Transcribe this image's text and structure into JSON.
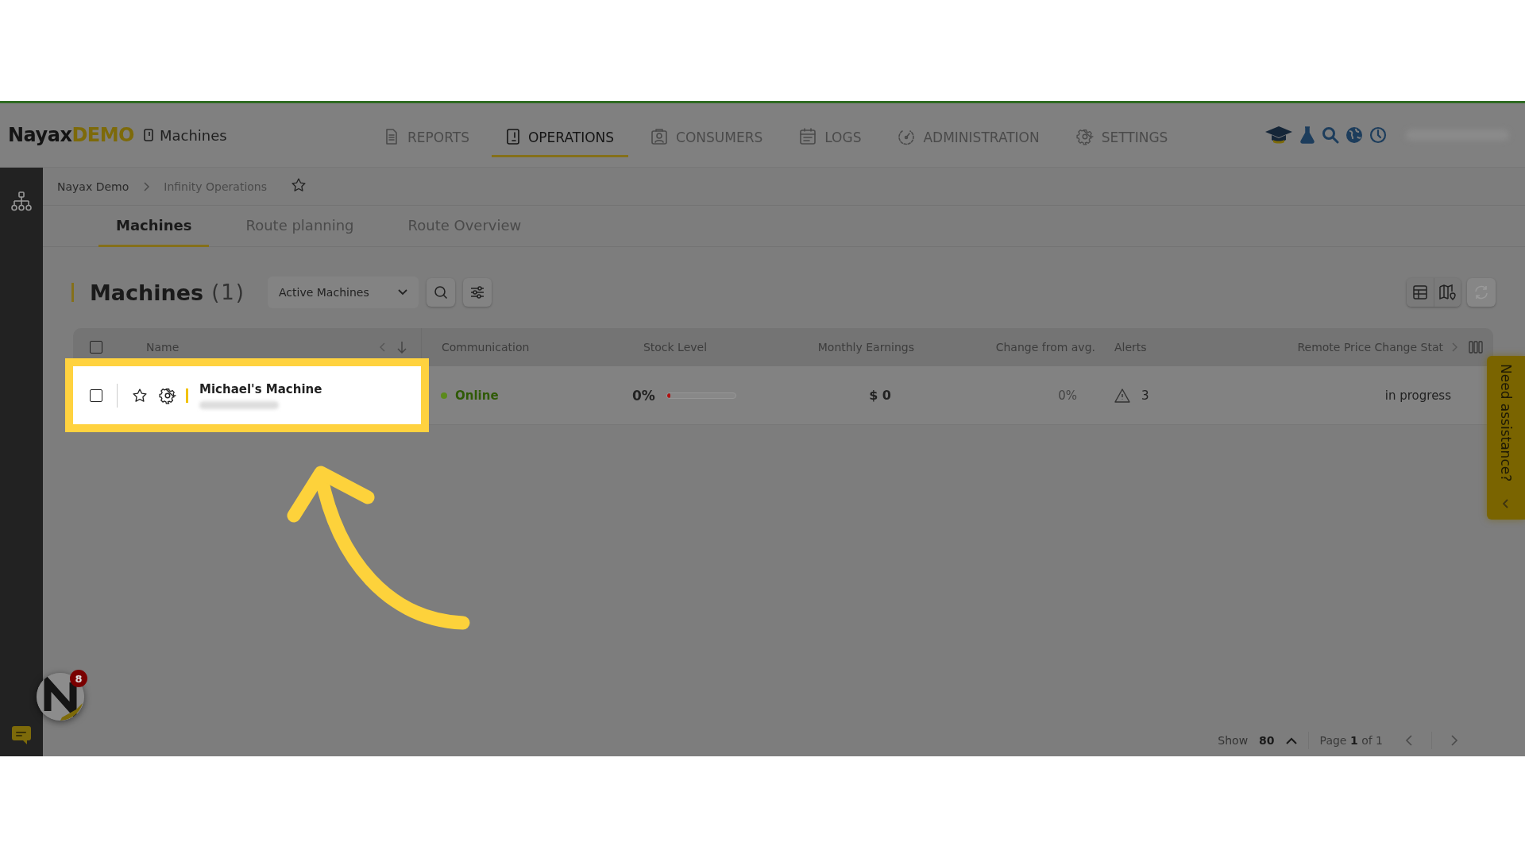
{
  "header": {
    "logo_brand": "Nayax",
    "logo_suffix": "DEMO",
    "page_title": "Machines",
    "nav": [
      {
        "label": "REPORTS",
        "kind": "report",
        "selected": false
      },
      {
        "label": "OPERATIONS",
        "kind": "device",
        "selected": true
      },
      {
        "label": "CONSUMERS",
        "kind": "person",
        "selected": false
      },
      {
        "label": "LOGS",
        "kind": "log",
        "selected": false
      },
      {
        "label": "ADMINISTRATION",
        "kind": "gauge",
        "selected": false
      },
      {
        "label": "SETTINGS",
        "kind": "settings",
        "selected": false
      }
    ]
  },
  "breadcrumb": [
    "Nayax Demo",
    "Infinity Operations"
  ],
  "tabs": [
    {
      "label": "Machines",
      "selected": true
    },
    {
      "label": "Route planning",
      "selected": false
    },
    {
      "label": "Route Overview",
      "selected": false
    }
  ],
  "toolbar": {
    "title": "Machines",
    "count": "(1)",
    "filter": "Active Machines"
  },
  "table": {
    "select_all_checked": false,
    "columns": [
      "Name",
      "Communication",
      "Stock Level",
      "Monthly Earnings",
      "Change from avg.",
      "Alerts",
      "Remote Price Change Stat"
    ],
    "rows": [
      {
        "name": "Michael's Machine",
        "checked": false,
        "favorite": false,
        "highlighted": true,
        "communication": "Online",
        "online": true,
        "stock": "0%",
        "level": 0,
        "monthly_earnings": "$ 0",
        "change": "0%",
        "alerts": "3",
        "remote_price_change": "in progress"
      }
    ]
  },
  "pagination": {
    "show_label": "Show",
    "page_size": "80",
    "page_text": "Page **1** of 1"
  },
  "notification_count": "8",
  "assistance_tab": "Need assistance?"
}
